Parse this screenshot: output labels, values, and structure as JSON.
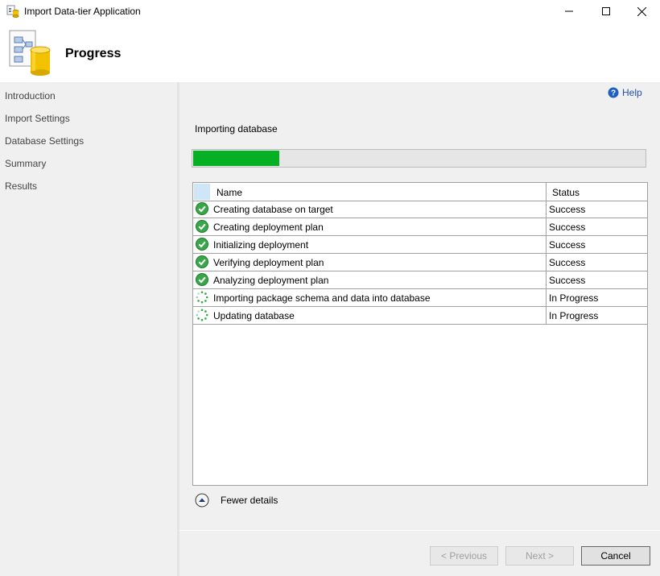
{
  "window": {
    "title": "Import Data-tier Application"
  },
  "header": {
    "title": "Progress"
  },
  "sidebar": {
    "items": [
      {
        "label": "Introduction"
      },
      {
        "label": "Import Settings"
      },
      {
        "label": "Database Settings"
      },
      {
        "label": "Summary"
      },
      {
        "label": "Results"
      }
    ]
  },
  "main": {
    "help_label": "Help",
    "section_label": "Importing database",
    "progress": 0.19,
    "table": {
      "columns": [
        "Name",
        "Status"
      ],
      "rows": [
        {
          "name": "Creating database on target",
          "status": "Success",
          "icon": "success-check-icon"
        },
        {
          "name": "Creating deployment plan",
          "status": "Success",
          "icon": "success-check-icon"
        },
        {
          "name": "Initializing deployment",
          "status": "Success",
          "icon": "success-check-icon"
        },
        {
          "name": "Verifying deployment plan",
          "status": "Success",
          "icon": "success-check-icon"
        },
        {
          "name": "Analyzing deployment plan",
          "status": "Success",
          "icon": "success-check-icon"
        },
        {
          "name": "Importing package schema and data into database",
          "status": "In Progress",
          "icon": "in-progress-spinner-icon"
        },
        {
          "name": "Updating database",
          "status": "In Progress",
          "icon": "in-progress-spinner-icon"
        }
      ]
    },
    "fewer_details_label": "Fewer details"
  },
  "buttons": {
    "previous": "< Previous",
    "next": "Next >",
    "cancel": "Cancel"
  },
  "colors": {
    "progress_fill": "#06b025",
    "success_green": "#2e9e3a",
    "help_link": "#1f4fb0"
  }
}
